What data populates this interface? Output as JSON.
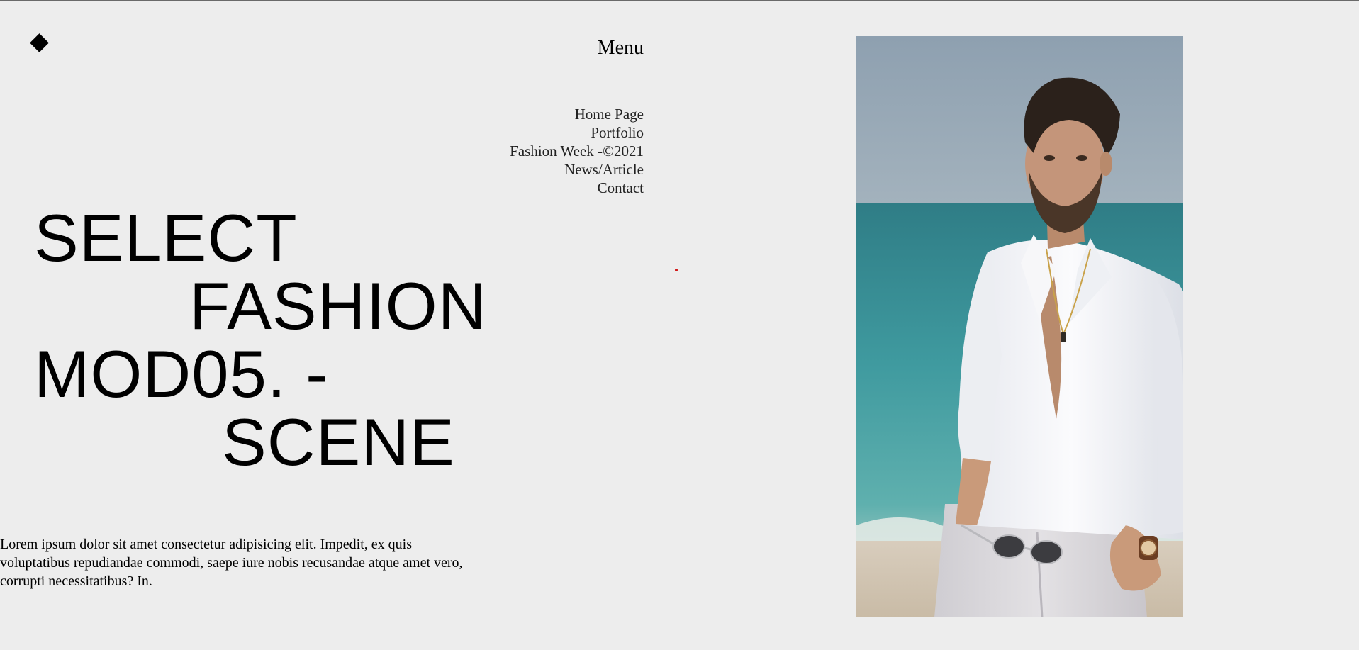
{
  "header": {
    "logo_icon": "diamond-icon",
    "menu_label": "Menu"
  },
  "nav": {
    "items": [
      {
        "label": "Home Page"
      },
      {
        "label": "Portfolio"
      },
      {
        "label": "Fashion Week -©2021"
      },
      {
        "label": "News/Article"
      },
      {
        "label": "Contact"
      }
    ]
  },
  "hero": {
    "lines": [
      "SELECT",
      "FASHION",
      "MOD05. -",
      "SCENE"
    ]
  },
  "intro": {
    "text": "Lorem ipsum dolor sit amet consectetur adipisicing elit. Impedit, ex quis voluptatibus repudiandae commodi, saepe iure nobis recusandae atque amet vero, corrupti necessitatibus? In."
  },
  "photo": {
    "subject": "model-beach-photo"
  },
  "colors": {
    "background": "#ededed",
    "text": "#000000",
    "accent_dot": "#d11818"
  }
}
